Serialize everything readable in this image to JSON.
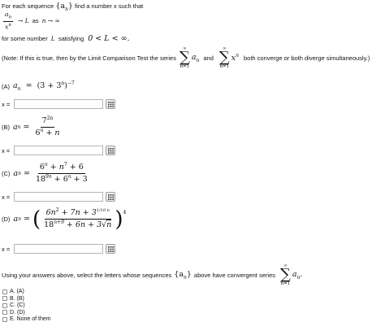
{
  "intro": {
    "text_a": "For each sequence",
    "seq_symbol": "{a",
    "seq_sub": "n",
    "seq_close": "}",
    "text_b": "find a number x such that",
    "ratio_num": "a",
    "ratio_num_sub": "n",
    "ratio_den": "x",
    "ratio_den_sup": "n",
    "arrow_text": "→ L",
    "as_text": "as",
    "limit_text": "n → ∞",
    "some_text": "for some number",
    "L_symbol": "L",
    "satisfying_text": "satisfying",
    "ineq_text": "0 < L < ∞."
  },
  "note": {
    "text_a": "(Note: If this is true, then by the Limit Comparison Test the series",
    "sum_top": "∞",
    "sum_sign": "∑",
    "sum_bottom": "n=1",
    "term_a": "a",
    "term_a_sub": "n",
    "and_text": "and",
    "term_x": "x",
    "term_x_sup": "n",
    "text_b": "both converge or both diverge simultaneously.)"
  },
  "parts": [
    {
      "label": "(A)",
      "lhs": "a",
      "lhs_sub": "n",
      "eq": "=",
      "expr": "(3 + 3",
      "expr_sup": "n",
      "expr_close": ")",
      "expr_close_sup": "−7"
    },
    {
      "label": "(B)",
      "lhs": "a",
      "lhs_sub": "n",
      "eq": "=",
      "num": "7",
      "num_sup": "2n",
      "den": "6",
      "den_sup": "n",
      "den_rest": " + n"
    },
    {
      "label": "(C)",
      "lhs": "a",
      "lhs_sub": "n",
      "eq": "=",
      "num_a": "6",
      "num_a_sup": "n",
      "num_b": " + n",
      "num_b_sup": "7",
      "num_c": " + 6",
      "den_a": "18",
      "den_a_sup": "9n",
      "den_b": " + 6",
      "den_b_sup": "n",
      "den_c": " + 3"
    },
    {
      "label": "(D)",
      "lhs": "a",
      "lhs_sub": "n",
      "eq": "=",
      "num_a": "6n",
      "num_a_sup": "2",
      "num_b": " + 7n + 3",
      "num_b_sup": "1/10 n",
      "den_a": "18",
      "den_a_sup": "n+9",
      "den_b": " + 6n + 3",
      "den_sqrt": "n",
      "outer_sup": "4"
    }
  ],
  "answer_rows": [
    {
      "x_label": "x =",
      "value": ""
    },
    {
      "x_label": "x =",
      "value": ""
    },
    {
      "x_label": "x =",
      "value": ""
    },
    {
      "x_label": "x =",
      "value": ""
    }
  ],
  "question": {
    "text_a": "Using your answers above, select the letters whose sequences",
    "seq": "{a",
    "seq_sub": "n",
    "seq_close": "}",
    "text_b": "above have convergent series",
    "sum_top": "∞",
    "sum_sign": "∑",
    "sum_bottom": "n=1",
    "term": "a",
    "term_sub": "n",
    "term_end": "."
  },
  "choices": [
    {
      "label": "A. (A)",
      "checked": false
    },
    {
      "label": "B. (B)",
      "checked": false
    },
    {
      "label": "C. (C)",
      "checked": false
    },
    {
      "label": "D. (D)",
      "checked": false
    },
    {
      "label": "E. None of them",
      "checked": false
    }
  ]
}
